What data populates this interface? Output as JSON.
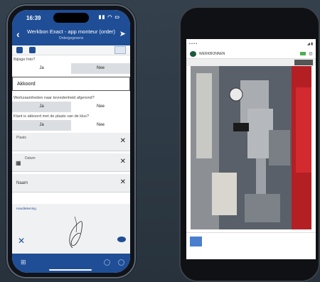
{
  "iphone": {
    "status_time": "16:39",
    "title": "Werkbon Exact - app monteur (order)",
    "subtitle": "Ordergegevens",
    "questions": [
      {
        "label": "Bijlage foto?",
        "yes": "Ja",
        "no": "Nee"
      },
      {
        "label": "Werkzaamheden naar tevredenheid afgerond?",
        "yes": "Ja",
        "no": "Nee"
      },
      {
        "label": "Klant is akkoord met de plaats van de klus?",
        "yes": "Ja",
        "no": "Nee"
      }
    ],
    "akkoord_value": "Akkoord",
    "fields": {
      "plaats_label": "Plaats",
      "datum_label": "Datum",
      "naam_label": "Naam"
    },
    "signature_label": "Handtekening"
  },
  "android": {
    "app_title": "WERKBONNEN"
  },
  "colors": {
    "primary": "#1f4e96",
    "background": "#2a3540"
  }
}
